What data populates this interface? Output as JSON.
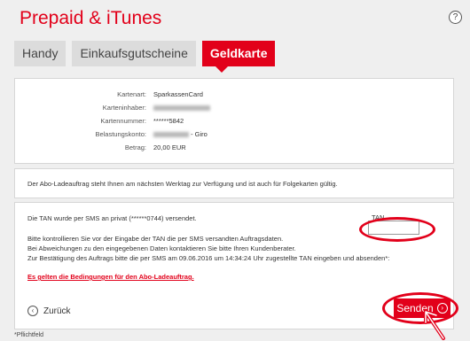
{
  "header": {
    "title": "Prepaid & iTunes",
    "help_label": "?"
  },
  "tabs": [
    {
      "label": "Handy"
    },
    {
      "label": "Einkaufsgutscheine"
    },
    {
      "label": "Geldkarte"
    }
  ],
  "details": {
    "kartenart_label": "Kartenart:",
    "kartenart_value": "SparkassenCard",
    "inhaber_label": "Karteninhaber:",
    "nummer_label": "Kartennummer:",
    "nummer_value": "******5842",
    "konto_label": "Belastungskonto:",
    "konto_suffix": "- Giro",
    "betrag_label": "Betrag:",
    "betrag_value": "20,00 EUR"
  },
  "info": {
    "text": "Der Abo-Ladeauftrag steht Ihnen am nächsten Werktag zur Verfügung und ist auch für Folgekarten gültig."
  },
  "tan_section": {
    "sent_text": "Die TAN wurde per SMS an privat (******0744) versendet.",
    "line1": "Bitte kontrollieren Sie vor der Eingabe der TAN die per SMS versandten Auftragsdaten.",
    "line2": "Bei Abweichungen zu den eingegebenen Daten kontaktieren Sie bitte Ihren Kundenberater.",
    "line3": "Zur Bestätigung des Auftrags bitte die per SMS am 09.06.2016 um 14:34:24 Uhr zugestellte TAN eingeben und absenden*:",
    "terms_link": "Es gelten die Bedingungen für den Abo-Ladeauftrag.",
    "tan_label": "TAN",
    "tan_value": ""
  },
  "actions": {
    "back_label": "Zurück",
    "send_label": "Senden"
  },
  "footer": {
    "note": "*Pflichtfeld"
  },
  "colors": {
    "accent": "#e2001a",
    "background": "#efefef"
  }
}
